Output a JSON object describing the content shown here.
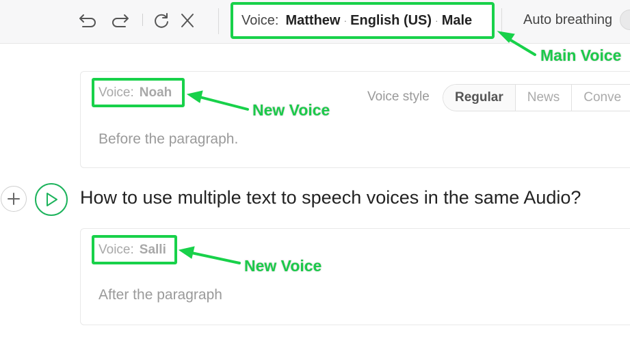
{
  "toolbar": {
    "icons": [
      "undo-icon",
      "redo-icon",
      "refresh-icon",
      "close-icon"
    ],
    "main_voice": {
      "label": "Voice:",
      "name": "Matthew",
      "separator": "·",
      "language": "English (US)",
      "gender": "Male"
    },
    "auto_breathing_label": "Auto breathing"
  },
  "blocks": [
    {
      "voice_label": "Voice:",
      "voice_name": "Noah",
      "voice_style_label": "Voice style",
      "styles": [
        "Regular",
        "News",
        "Conve"
      ],
      "active_style": "Regular",
      "text": "Before the paragraph."
    },
    {
      "voice_label": "Voice:",
      "voice_name": "Salli",
      "text": "After the paragraph"
    }
  ],
  "headline": "How to use multiple text to speech voices in the same Audio?",
  "annotations": {
    "main_voice": "Main Voice",
    "new_voice_1": "New Voice",
    "new_voice_2": "New Voice"
  },
  "colors": {
    "highlight_green": "#18d14a",
    "play_green": "#1db35c"
  }
}
